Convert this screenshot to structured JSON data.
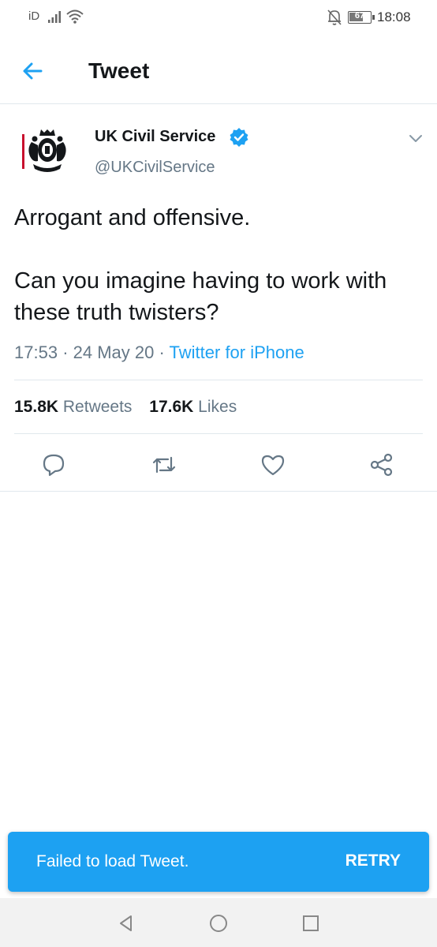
{
  "status_bar": {
    "carrier": "iD",
    "battery": "67",
    "battery_level": 67,
    "time": "18:08"
  },
  "app_bar": {
    "title": "Tweet",
    "back_icon": "arrow-left-icon"
  },
  "tweet": {
    "author_name": "UK Civil Service",
    "verified": true,
    "handle": "@UKCivilService",
    "text_paragraphs": [
      "Arrogant and offensive.",
      "Can you imagine having to work with these truth twisters?"
    ],
    "time": "17:53",
    "date": "24 May 20",
    "source": "Twitter for iPhone",
    "retweets_count": "15.8K",
    "retweets_label": "Retweets",
    "likes_count": "17.6K",
    "likes_label": "Likes"
  },
  "actions": [
    "reply-icon",
    "retweet-icon",
    "like-icon",
    "share-icon"
  ],
  "snackbar": {
    "message": "Failed to load Tweet.",
    "action": "RETRY"
  },
  "colors": {
    "accent": "#1da1f2",
    "text": "#14171a",
    "secondary": "#657786",
    "divider": "#e1e8ed"
  }
}
